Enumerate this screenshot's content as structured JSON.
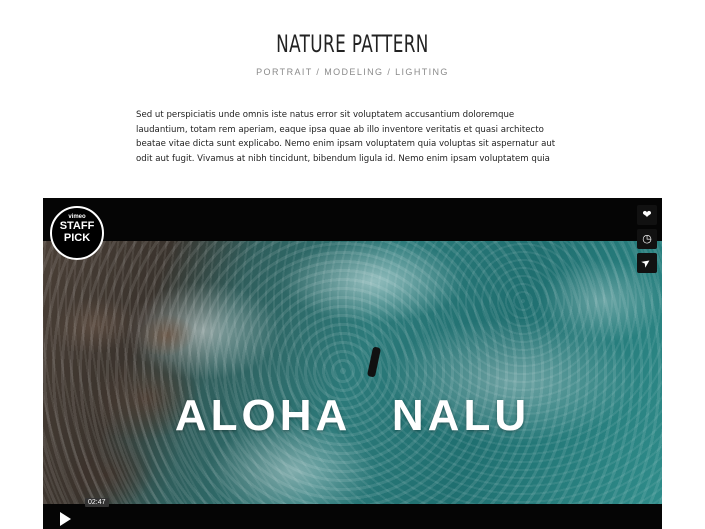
{
  "page": {
    "title": "NATURE PATTERN",
    "subtitle": "PORTRAIT / MODELING / LIGHTING",
    "intro": "Sed ut perspiciatis unde omnis iste natus error sit voluptatem accusantium doloremque laudantium, totam rem aperiam, eaque ipsa quae ab illo inventore veritatis et quasi architecto beatae vitae dicta sunt explicabo. Nemo enim ipsam voluptatem quia voluptas sit aspernatur aut odit aut fugit. Vivamus at nibh tincidunt, bibendum ligula id. Nemo enim ipsam voluptatem quia"
  },
  "video": {
    "title": "ALOHA NALU",
    "badge": {
      "line1": "vimeo",
      "line2": "STAFF",
      "line3": "PICK"
    },
    "timecode": "02:47",
    "side_buttons": [
      {
        "name": "like-button",
        "icon": "heart-icon",
        "glyph": "❤"
      },
      {
        "name": "watch-later-button",
        "icon": "clock-icon",
        "glyph": "◷"
      },
      {
        "name": "share-button",
        "icon": "paper-plane-icon",
        "glyph": "➤"
      }
    ]
  }
}
